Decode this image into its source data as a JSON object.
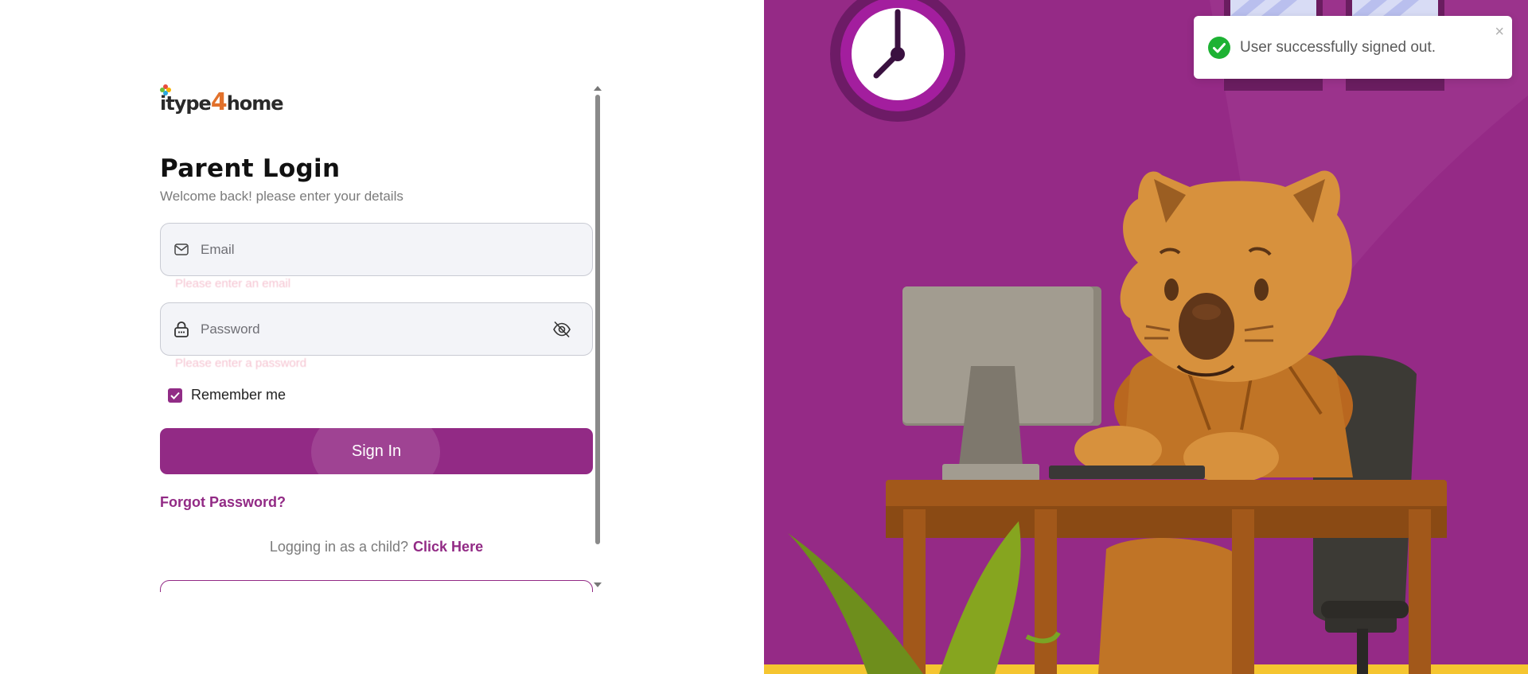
{
  "brand": {
    "logo_text_pre": "itype",
    "logo_text_num": "4",
    "logo_text_post": "home"
  },
  "login": {
    "title": "Parent Login",
    "subtitle": "Welcome back! please enter your details",
    "email_placeholder": "Email",
    "email_error": "Please enter an email",
    "password_placeholder": "Password",
    "password_error": "Please enter a password",
    "remember_label": "Remember me",
    "remember_checked": true,
    "signin_label": "Sign In",
    "forgot_label": "Forgot Password?",
    "child_prompt": "Logging in as a child?",
    "child_link": "Click Here"
  },
  "toast": {
    "message": "User successfully signed out.",
    "type": "success"
  },
  "colors": {
    "accent": "#922a85",
    "illustration_bg": "#952a86",
    "success": "#1db233",
    "error": "#e3537a"
  },
  "icons": {
    "email": "mail-icon",
    "password": "lock-icon",
    "visibility": "eye-off-icon",
    "toast_status": "check-circle-icon",
    "toast_close": "close-icon",
    "checkbox": "check-icon"
  }
}
